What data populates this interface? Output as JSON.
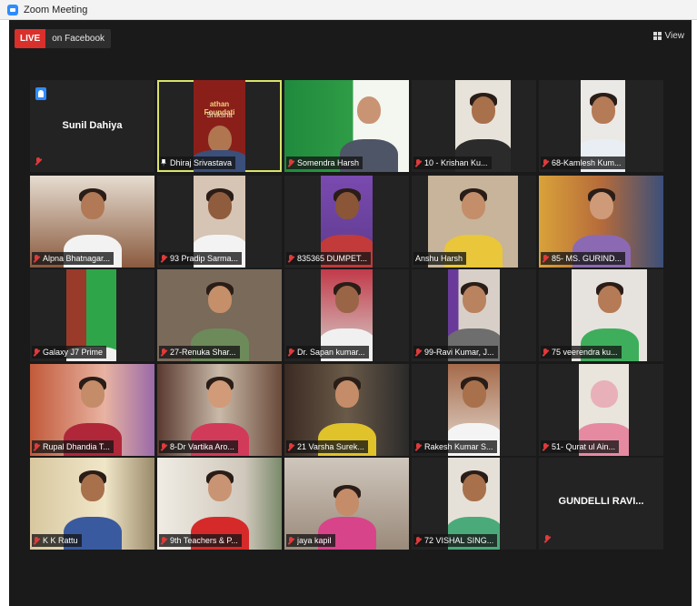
{
  "window_title": "Zoom Meeting",
  "toolbar": {
    "live_label": "LIVE",
    "facebook_label": "on Facebook",
    "view_label": "View"
  },
  "tiles": [
    {
      "name": "Sunil Dahiya",
      "video": false,
      "raised_hand": true
    },
    {
      "name": "Dhiraj Srivastava",
      "video": true,
      "active_speaker": true,
      "pinned": true,
      "banner_line1": "athan Foundati",
      "banner_line2": "Shiksha"
    },
    {
      "name": "Somendra Harsh",
      "video": true
    },
    {
      "name": "10 - Krishan Ku...",
      "video": true
    },
    {
      "name": "68-Kamlesh Kum...",
      "video": true
    },
    {
      "name": "Alpna Bhatnagar...",
      "video": true
    },
    {
      "name": "93 Pradip Sarma...",
      "video": true
    },
    {
      "name": "835365 DUMPET...",
      "video": true
    },
    {
      "name": "Anshu Harsh",
      "video": true
    },
    {
      "name": "85- MS. GURIND...",
      "video": true
    },
    {
      "name": "Galaxy J7 Prime",
      "video": true
    },
    {
      "name": "27-Renuka Shar...",
      "video": true
    },
    {
      "name": "Dr. Sapan kumar...",
      "video": true
    },
    {
      "name": "99-Ravi Kumar, J...",
      "video": true
    },
    {
      "name": "75 veerendra ku...",
      "video": true
    },
    {
      "name": "Rupal Dhandia T...",
      "video": true
    },
    {
      "name": "8-Dr Vartika Aro...",
      "video": true
    },
    {
      "name": "21 Varsha Surek...",
      "video": true
    },
    {
      "name": "Rakesh Kumar S...",
      "video": true
    },
    {
      "name": "51- Qurat ul Ain...",
      "video": true
    },
    {
      "name": "K K Rattu",
      "video": true
    },
    {
      "name": "9th Teachers & P...",
      "video": true
    },
    {
      "name": "jaya kapil",
      "video": true
    },
    {
      "name": "72 VISHAL SING...",
      "video": true
    },
    {
      "name": "GUNDELLI RAVI...",
      "video": false
    }
  ],
  "colors": {
    "live_red": "#d9302c",
    "active_speaker": "#d9e36a",
    "muted_mic": "#e03a3a",
    "raised_hand": "#2d8cff"
  }
}
